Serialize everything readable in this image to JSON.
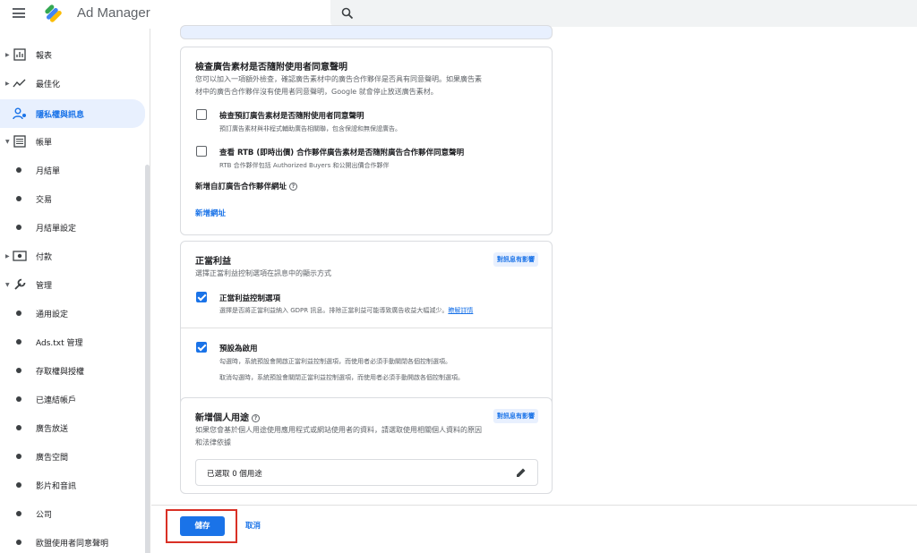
{
  "header": {
    "app_title": "Ad Manager",
    "search_placeholder": ""
  },
  "sidebar": {
    "items": [
      {
        "label": "報表",
        "icon": "bar-chart-icon",
        "type": "group"
      },
      {
        "label": "最佳化",
        "icon": "trend-icon",
        "type": "group"
      },
      {
        "label": "隱私權與訊息",
        "icon": "privacy-user-icon",
        "type": "active"
      },
      {
        "label": "帳單",
        "icon": "billing-list-icon",
        "type": "group"
      },
      {
        "label": "月結單",
        "type": "sub"
      },
      {
        "label": "交易",
        "type": "sub"
      },
      {
        "label": "月結單設定",
        "type": "sub"
      },
      {
        "label": "付款",
        "icon": "payment-icon",
        "type": "group"
      },
      {
        "label": "管理",
        "icon": "wrench-icon",
        "type": "group"
      },
      {
        "label": "通用設定",
        "type": "sub"
      },
      {
        "label": "Ads.txt 管理",
        "type": "sub"
      },
      {
        "label": "存取權與授權",
        "type": "sub"
      },
      {
        "label": "已連結帳戶",
        "type": "sub"
      },
      {
        "label": "廣告放送",
        "type": "sub"
      },
      {
        "label": "廣告空間",
        "type": "sub"
      },
      {
        "label": "影片和音訊",
        "type": "sub"
      },
      {
        "label": "公司",
        "type": "sub"
      },
      {
        "label": "歐盟使用者同意聲明",
        "type": "sub"
      }
    ]
  },
  "consent_card": {
    "title": "檢查廣告素材是否隨附使用者同意聲明",
    "desc_line1": "您可以加入一項額外檢查，確認廣告素材中的廣告合作夥伴是否具有同意聲明。如果廣告素",
    "desc_line2": "材中的廣告合作夥伴沒有使用者同意聲明，Google 就會停止放送廣告素材。",
    "options": [
      {
        "title": "檢查預訂廣告素材是否隨附使用者同意聲明",
        "desc": "預訂廣告素材與非程式輔助廣告相關聯，包含保證和無保證廣告。",
        "checked": false
      },
      {
        "title": "查看 RTB (即時出價) 合作夥伴廣告素材是否隨附廣告合作夥伴同意聲明",
        "desc": "RTB 合作夥伴包括 Authorized Buyers 和公開出價合作夥伴",
        "checked": false
      }
    ],
    "custom_partner_label": "新增自訂廣告合作夥伴網址",
    "add_url_link": "新增網址"
  },
  "legit_card": {
    "title": "正當利益",
    "badge": "對訊息有影響",
    "desc": "選擇正當利益控制選項在訊息中的顯示方式",
    "opt1_title": "正當利益控制選項",
    "opt1_desc": "選擇是否將正當利益納入 GDPR 訊息。排除正當利益可能導致廣告收益大幅減少。",
    "opt1_link": "瞭解詳情",
    "opt1_checked": true,
    "opt2_title": "預設為啟用",
    "opt2_desc1": "勾選時，系統預設會開啟正當利益控制選項，而使用者必須手動關閉各個控制選項。",
    "opt2_desc2": "取消勾選時，系統預設會關閉正當利益控制選項，而使用者必須手動開啟各個控制選項。",
    "opt2_checked": true
  },
  "purpose_card": {
    "title": "新增個人用途",
    "badge": "對訊息有影響",
    "desc_line1": "如果您會基於個人用途使用應用程式或網站使用者的資料，請選取使用相關個人資料的原因",
    "desc_line2": "和法律依據",
    "selected_text": "已選取 0 個用途"
  },
  "footer": {
    "save_label": "儲存",
    "cancel_label": "取消"
  },
  "colors": {
    "accent": "#1a73e8",
    "highlight": "#d93025"
  }
}
